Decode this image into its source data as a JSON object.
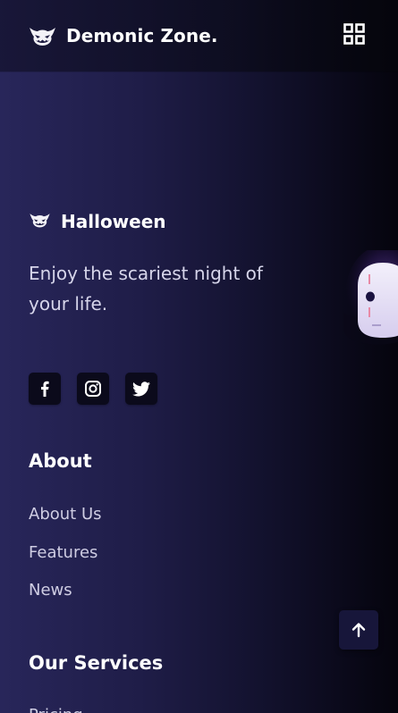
{
  "header": {
    "logo_icon": "demon-face-icon",
    "title": "Demonic Zone.",
    "menu_icon": "grid-menu-icon"
  },
  "footer": {
    "brand": {
      "icon": "demon-face-icon",
      "title": "Halloween"
    },
    "tagline": "Enjoy the scariest night of your life.",
    "social": [
      {
        "name": "facebook",
        "icon": "facebook-icon"
      },
      {
        "name": "instagram",
        "icon": "instagram-icon"
      },
      {
        "name": "twitter",
        "icon": "twitter-icon"
      }
    ],
    "about": {
      "title": "About",
      "links": [
        "About Us",
        "Features",
        "News"
      ]
    },
    "services": {
      "title": "Our Services",
      "partial_link": "Pricing"
    }
  },
  "decor": {
    "ghost_icon": "masked-ghost-icon"
  },
  "back_to_top": {
    "icon": "arrow-up-icon"
  },
  "colors": {
    "background_start": "#28265a",
    "background_end": "#05040d",
    "text_primary": "#ffffff",
    "text_muted": "#cfcde3",
    "button_bg": "#0b0a1b"
  }
}
